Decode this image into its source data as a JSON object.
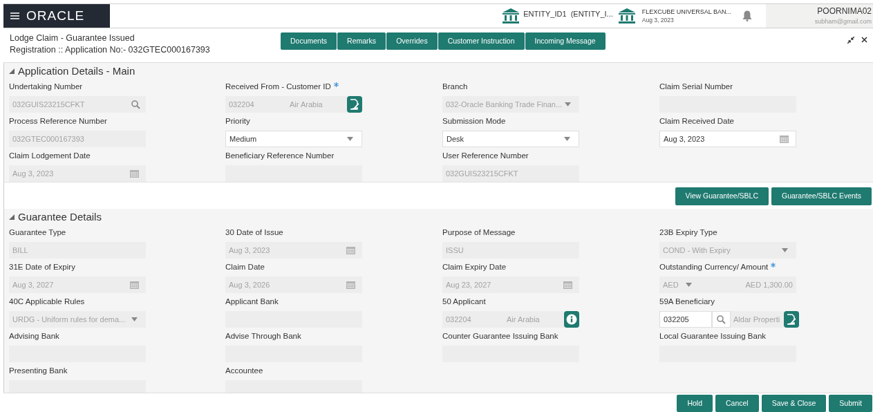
{
  "header": {
    "brand": "ORACLE",
    "entity": "ENTITY_ID1  (ENTITY_I...",
    "bank": {
      "name": "FLEXCUBE UNIVERSAL BAN...",
      "date": "Aug 3, 2023"
    },
    "user": {
      "name": "POORNIMA02",
      "email": "subham@gmail.com"
    }
  },
  "title": {
    "heading": "Lodge Claim - Guarantee Issued",
    "subheading": "Registration ::  Application No:- 032GTEC000167393"
  },
  "toolbar": [
    "Documents",
    "Remarks",
    "Overrides",
    "Customer Instruction",
    "Incoming Message"
  ],
  "sections": [
    {
      "title": "Application Details - Main",
      "expanded": true,
      "fields": [
        {
          "label": "Undertaking Number",
          "kind": "search",
          "value": "032GUIS23215CFKT",
          "disabled": true,
          "required": false
        },
        {
          "label": "Received From - Customer ID",
          "kind": "party",
          "id": "032204",
          "name": "Air Arabia",
          "disabled": true,
          "required": true
        },
        {
          "label": "Branch",
          "kind": "select",
          "value": "032-Oracle Banking Trade Finan...",
          "disabled": true,
          "required": false
        },
        {
          "label": "Claim Serial Number",
          "kind": "text",
          "disabled": true,
          "required": false
        },
        {
          "label": "Process Reference Number",
          "kind": "text",
          "value": "032GTEC000167393",
          "disabled": true,
          "required": false
        },
        {
          "label": "Priority",
          "kind": "select",
          "value": "Medium",
          "disabled": false,
          "required": false
        },
        {
          "label": "Submission Mode",
          "kind": "select",
          "value": "Desk",
          "disabled": false,
          "required": false
        },
        {
          "label": "Claim Received Date",
          "kind": "date",
          "value": "Aug 3, 2023",
          "disabled": false,
          "required": false
        },
        {
          "label": "Claim Lodgement Date",
          "kind": "date",
          "value": "Aug 3, 2023",
          "disabled": true,
          "required": false
        },
        {
          "label": "Beneficiary Reference Number",
          "kind": "text",
          "disabled": true,
          "required": false
        },
        {
          "label": "User Reference Number",
          "kind": "text",
          "value": "032GUIS23215CFKT",
          "disabled": true,
          "required": false
        }
      ],
      "actions": [
        "View Guarantee/SBLC",
        "Guarantee/SBLC Events"
      ]
    },
    {
      "title": "Guarantee Details",
      "expanded": true,
      "fields": [
        {
          "label": "Guarantee Type",
          "kind": "text",
          "value": "BILL",
          "disabled": true,
          "required": false
        },
        {
          "label": "30 Date of Issue",
          "kind": "date",
          "value": "Aug 3, 2023",
          "disabled": true,
          "required": false
        },
        {
          "label": "Purpose of Message",
          "kind": "text",
          "value": "ISSU",
          "disabled": true,
          "required": false
        },
        {
          "label": "23B Expiry Type",
          "kind": "select",
          "value": "COND - With Expiry",
          "disabled": true,
          "required": false
        },
        {
          "label": "31E Date of Expiry",
          "kind": "date",
          "value": "Aug 3, 2027",
          "disabled": true,
          "required": false
        },
        {
          "label": "Claim Date",
          "kind": "date",
          "value": "Aug 3, 2026",
          "disabled": true,
          "required": false
        },
        {
          "label": "Claim Expiry Date",
          "kind": "date",
          "value": "Aug 23, 2027",
          "disabled": true,
          "required": false
        },
        {
          "label": "Outstanding Currency/ Amount",
          "kind": "amount",
          "currency": "AED",
          "value": "AED 1,300.00",
          "disabled": true,
          "required": true
        },
        {
          "label": "40C Applicable Rules",
          "kind": "select",
          "value": "URDG - Uniform rules for dema...",
          "disabled": true,
          "required": false
        },
        {
          "label": "Applicant Bank",
          "kind": "text",
          "disabled": true,
          "required": false
        },
        {
          "label": "50 Applicant",
          "kind": "party-info",
          "id": "032204",
          "name": "Air Arabia",
          "disabled": true,
          "required": false
        },
        {
          "label": "59A Beneficiary",
          "kind": "lookup",
          "id": "032205",
          "name": "Aldar Properti",
          "disabled": false,
          "required": false
        },
        {
          "label": "Advising Bank",
          "kind": "text",
          "disabled": true,
          "required": false
        },
        {
          "label": "Advise Through Bank",
          "kind": "text",
          "disabled": true,
          "required": false
        },
        {
          "label": "Counter Guarantee Issuing Bank",
          "kind": "text",
          "disabled": true,
          "required": false
        },
        {
          "label": "Local Guarantee Issuing Bank",
          "kind": "text",
          "disabled": true,
          "required": false
        },
        {
          "label": "Presenting Bank",
          "kind": "text",
          "disabled": true,
          "required": false
        },
        {
          "label": "Accountee",
          "kind": "text",
          "disabled": true,
          "required": false
        }
      ]
    }
  ],
  "footer": [
    "Hold",
    "Cancel",
    "Save & Close",
    "Submit"
  ]
}
